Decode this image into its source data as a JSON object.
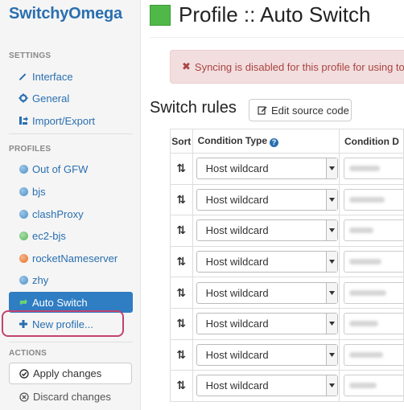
{
  "sidebar": {
    "brand": "SwitchyOmega",
    "settings_header": "SETTINGS",
    "settings_items": [
      {
        "label": "Interface",
        "icon": "wrench-icon"
      },
      {
        "label": "General",
        "icon": "gear-icon"
      },
      {
        "label": "Import/Export",
        "icon": "import-export-icon"
      }
    ],
    "profiles_header": "PROFILES",
    "profiles": [
      {
        "label": "Out of GFW",
        "icon": "globe-icon",
        "color": "#4a90c8"
      },
      {
        "label": "bjs",
        "icon": "globe-icon",
        "color": "#4a90c8"
      },
      {
        "label": "clashProxy",
        "icon": "globe-icon",
        "color": "#4a90c8"
      },
      {
        "label": "ec2-bjs",
        "icon": "globe-icon",
        "color": "#5cb85c"
      },
      {
        "label": "rocketNameserver",
        "icon": "globe-icon",
        "color": "#e8702a"
      },
      {
        "label": "zhy",
        "icon": "globe-icon",
        "color": "#4a90c8"
      }
    ],
    "active_profile": {
      "label": "Auto Switch",
      "icon": "auto-switch-icon",
      "color": "#50b848"
    },
    "new_profile": "New profile...",
    "actions_header": "ACTIONS",
    "apply_changes": "Apply changes",
    "discard_changes": "Discard changes"
  },
  "main": {
    "title": "Profile :: Auto Switch",
    "title_color": "#50b848",
    "alert": "Syncing is disabled for this profile for using too m",
    "section_title": "Switch rules",
    "edit_source": "Edit source code",
    "table": {
      "headers": [
        "Sort",
        "Condition Type",
        "Condition D"
      ],
      "rows": [
        {
          "condition_type": "Host wildcard"
        },
        {
          "condition_type": "Host wildcard"
        },
        {
          "condition_type": "Host wildcard"
        },
        {
          "condition_type": "Host wildcard"
        },
        {
          "condition_type": "Host wildcard"
        },
        {
          "condition_type": "Host wildcard"
        },
        {
          "condition_type": "Host wildcard"
        },
        {
          "condition_type": "Host wildcard"
        }
      ]
    }
  }
}
